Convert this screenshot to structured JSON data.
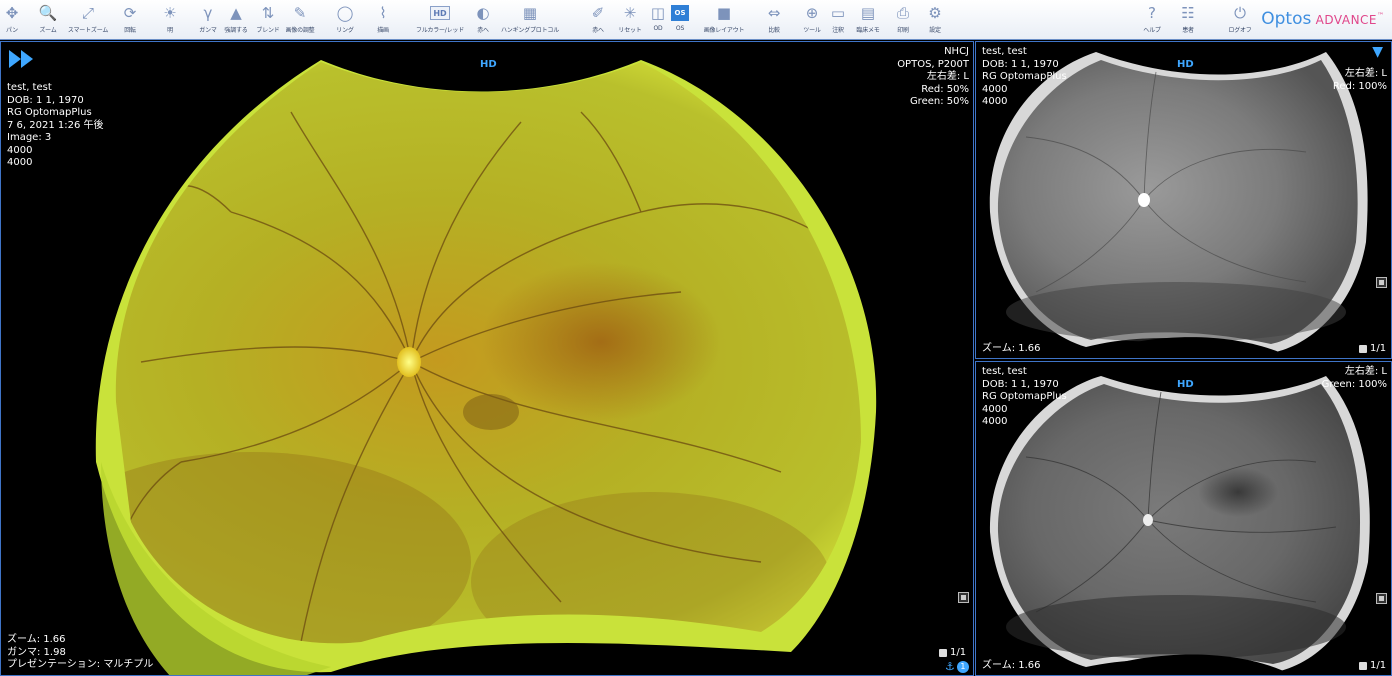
{
  "toolbar": {
    "buttons": [
      {
        "label": "パン",
        "icon": "pan-icon"
      },
      {
        "label": "ズーム",
        "icon": "zoom-icon"
      },
      {
        "label": "スマートズーム",
        "icon": "smart-zoom-icon"
      },
      {
        "label": "回転",
        "icon": "rotate-icon"
      },
      {
        "label": "明",
        "icon": "brightness-icon"
      },
      {
        "label": "ガンマ",
        "icon": "gamma-icon"
      },
      {
        "label": "強調する",
        "icon": "enhance-icon"
      },
      {
        "label": "ブレンド",
        "icon": "blend-icon"
      },
      {
        "label": "画像の調整",
        "icon": "adjust-icon"
      },
      {
        "label": "リング",
        "icon": "ring-icon"
      },
      {
        "label": "描画",
        "icon": "draw-icon"
      },
      {
        "label": "フルカラー/レッド",
        "icon": "hd-icon",
        "badge": "HD"
      },
      {
        "label": "赤へ",
        "icon": "to-red-icon"
      },
      {
        "label": "ハンギングプロトコル",
        "icon": "hanging-protocol-icon"
      },
      {
        "label": "赤へ",
        "icon": "measure-icon"
      },
      {
        "label": "リセット",
        "icon": "reset-icon"
      },
      {
        "label": "OD",
        "icon": "od-icon"
      },
      {
        "label": "OS",
        "icon": "os-icon",
        "badge": "OS"
      },
      {
        "label": "画像レイアウト",
        "icon": "layout-icon"
      },
      {
        "label": "比較",
        "icon": "compare-icon"
      },
      {
        "label": "ツール",
        "icon": "tools-icon"
      },
      {
        "label": "注釈",
        "icon": "annotate-icon"
      },
      {
        "label": "臨床メモ",
        "icon": "clinical-note-icon"
      },
      {
        "label": "印刷",
        "icon": "print-icon"
      },
      {
        "label": "設定",
        "icon": "settings-icon"
      },
      {
        "label": "ヘルプ",
        "icon": "help-icon"
      },
      {
        "label": "患者",
        "icon": "patient-icon"
      },
      {
        "label": "ログオフ",
        "icon": "logoff-icon"
      }
    ],
    "brand_main": "Optos",
    "brand_sub": "Advance",
    "brand_tm": "™"
  },
  "main_view": {
    "hd": "HD",
    "info_left": [
      "test, test",
      "DOB: 1 1, 1970",
      "RG OptomapPlus",
      "7 6, 2021 1:26 午後",
      "Image: 3",
      "4000",
      "4000"
    ],
    "info_right": [
      "NHCJ",
      "OPTOS, P200T",
      "左右差: L",
      "Red: 50%",
      "Green: 50%"
    ],
    "info_bottom": [
      "ズーム: 1.66",
      "ガンマ: 1.98",
      "プレゼンテーション: マルチプル"
    ],
    "page": "1/1",
    "anchor_count": "1"
  },
  "top_view": {
    "hd": "HD",
    "info_left": [
      "test, test",
      "DOB: 1 1, 1970",
      "RG OptomapPlus",
      "4000",
      "4000"
    ],
    "info_right": [
      "左右差: L",
      "Red: 100%"
    ],
    "zoom": "ズーム: 1.66",
    "page": "1/1"
  },
  "bottom_view": {
    "hd": "HD",
    "info_left": [
      "test, test",
      "DOB: 1 1, 1970",
      "RG OptomapPlus",
      "4000",
      "4000"
    ],
    "info_right": [
      "左右差: L",
      "Green: 100%"
    ],
    "zoom": "ズーム: 1.66",
    "page": "1/1"
  },
  "colors": {
    "accent": "#3fa7ff",
    "panel_border": "#3f74c7",
    "fundus_green": "#c8d630",
    "fundus_orange": "#a86a1c"
  }
}
